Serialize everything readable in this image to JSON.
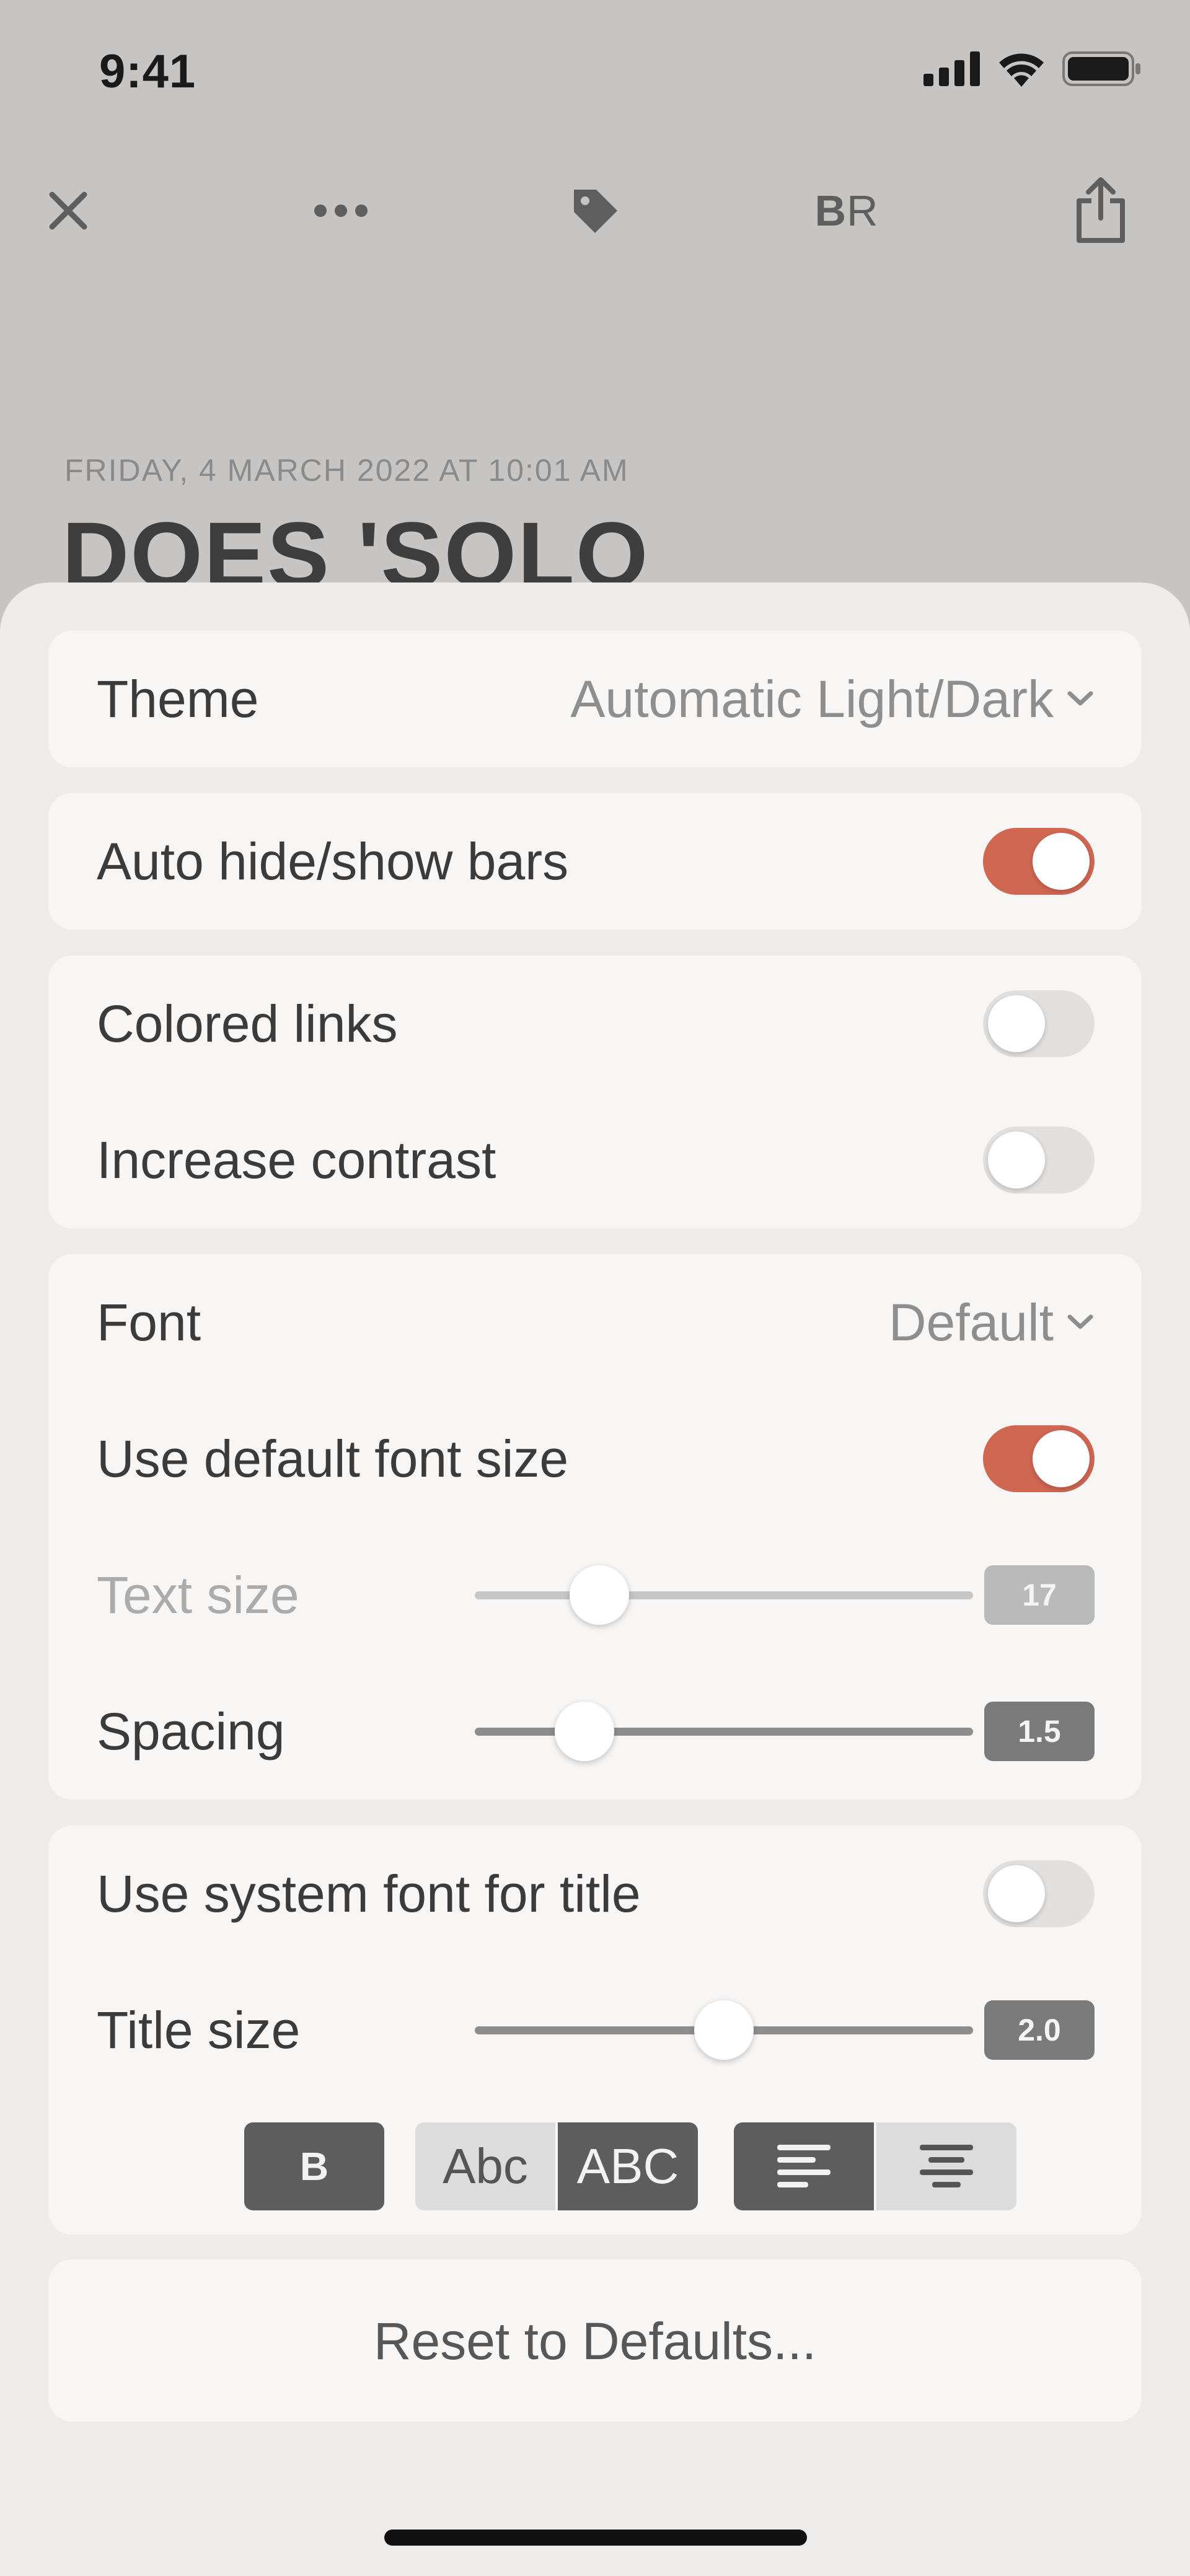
{
  "status_bar": {
    "time": "9:41"
  },
  "toolbar": {
    "close_icon": "close-icon",
    "more_icon": "more-icon",
    "tag_icon": "tag-icon",
    "reader_label": {
      "bold": "B",
      "regular": "R"
    },
    "share_icon": "share-icon"
  },
  "article": {
    "date": "FRIDAY, 4 MARCH 2022 AT 10:01 AM",
    "title": "DOES 'SOLO"
  },
  "settings": {
    "theme": {
      "label": "Theme",
      "value": "Automatic Light/Dark"
    },
    "auto_hide": {
      "label": "Auto hide/show bars",
      "on": true
    },
    "colored_links": {
      "label": "Colored links",
      "on": false
    },
    "increase_contrast": {
      "label": "Increase contrast",
      "on": false
    },
    "font": {
      "label": "Font",
      "value": "Default"
    },
    "default_font_size": {
      "label": "Use default font size",
      "on": true
    },
    "text_size": {
      "label": "Text size",
      "value": "17",
      "level": 0.25
    },
    "spacing": {
      "label": "Spacing",
      "value": "1.5",
      "level": 0.22
    },
    "system_font_title": {
      "label": "Use system font for title",
      "on": false
    },
    "title_size": {
      "label": "Title size",
      "value": "2.0",
      "level": 0.5
    },
    "format_buttons": {
      "bold": "B",
      "mixed_case": "Abc",
      "upper_case": "ABC",
      "align_left_icon": "align-left-icon",
      "align_center_icon": "align-center-icon"
    },
    "reset": "Reset to Defaults..."
  },
  "colors": {
    "accent": "#cf6753",
    "backdrop": "#c6c5c4",
    "sheet": "#edeceb",
    "card": "#f7f6f5"
  }
}
